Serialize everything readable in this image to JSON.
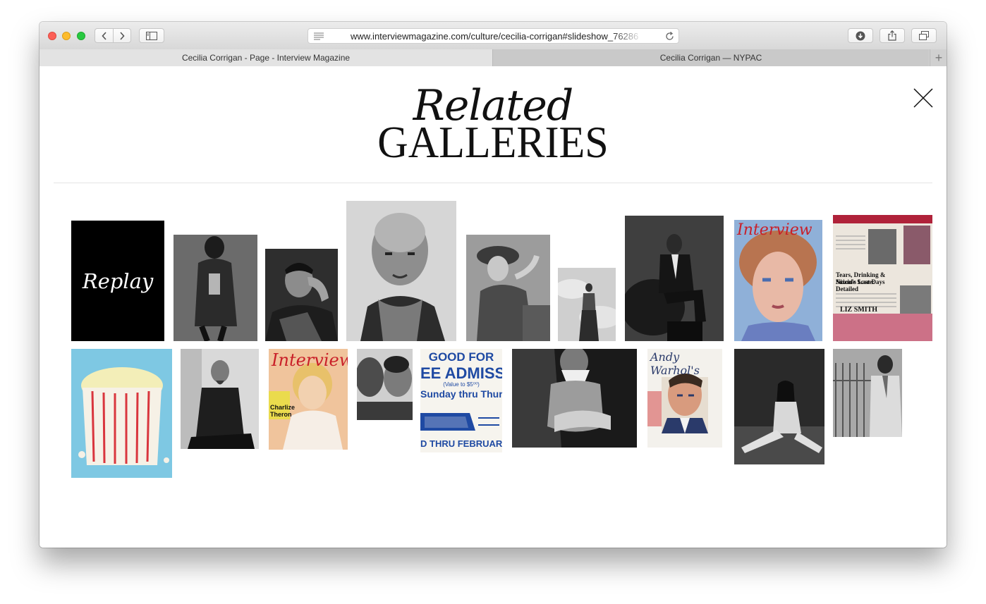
{
  "browser": {
    "url": "www.interviewmagazine.com/culture/cecilia-corrigan#slideshow_76286",
    "tabs": [
      {
        "label": "Cecilia Corrigan - Page - Interview Magazine"
      },
      {
        "label": "Cecilia Corrigan — NYPAC"
      }
    ],
    "icons": [
      "back-icon",
      "forward-icon",
      "sidebar-icon",
      "reader-icon",
      "reload-icon",
      "download-icon",
      "share-icon",
      "tabs-overview-icon",
      "new-tab-icon"
    ]
  },
  "page": {
    "title_line1": "Related",
    "title_line2": "GALLERIES",
    "close_icon": "close-icon"
  },
  "gallery": {
    "replay_label": "Replay",
    "cover_interview": "Interview",
    "cover_warhol": "Andy Warhol's",
    "ticket_line1": "GOOD FOR",
    "ticket_line2": "EE ADMISS",
    "ticket_line3": "(Value to $5⁰⁰)",
    "ticket_line4": "Sunday thru Thurs",
    "ticket_line5": "D THRU FEBRUAR",
    "news_head1": "Tears, Drinking & Suicide Scare:",
    "news_head2": "Nixon's Last Days Detailed",
    "news_byline": "LIZ SMITH",
    "cover_charlize": "Charlize Theron"
  }
}
